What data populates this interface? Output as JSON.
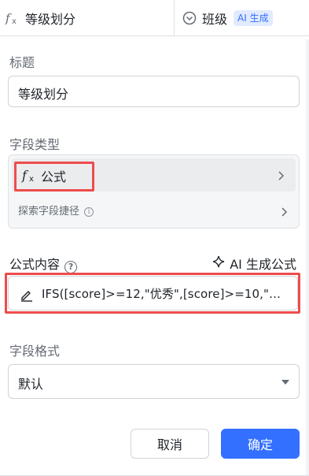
{
  "header": {
    "column_a": {
      "icon": "fx-icon",
      "title": "等级划分"
    },
    "column_b": {
      "icon": "chevron-circle-icon",
      "title": "班级",
      "badge": "AI 生成"
    }
  },
  "form": {
    "title_label": "标题",
    "title_value": "等级划分",
    "type_label": "字段类型",
    "type_value": "公式",
    "type_icon": "fx-icon",
    "explore_link": "探索字段捷径",
    "formula_label": "公式内容",
    "ai_formula_button": "AI 生成公式",
    "formula_value": "IFS([score]>=12,\"优秀\",[score]>=10,\"…",
    "format_label": "字段格式",
    "format_value": "默认"
  },
  "footer": {
    "cancel_label": "取消",
    "confirm_label": "确定"
  },
  "colors": {
    "primary": "#3370ff",
    "highlight": "#ee4c4c",
    "text": "#1f2329",
    "muted": "#646a73"
  }
}
